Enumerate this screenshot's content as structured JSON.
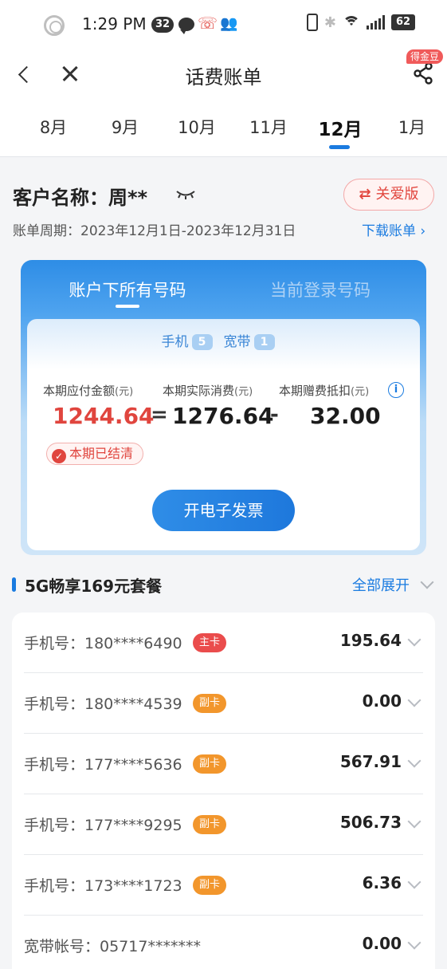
{
  "status_bar": {
    "time": "1:29 PM",
    "notif_count": "32",
    "battery": "62"
  },
  "nav": {
    "title": "话费账单",
    "share_tag": "得金豆"
  },
  "months": [
    "8月",
    "9月",
    "10月",
    "11月",
    "12月",
    "1月"
  ],
  "active_month": "12月",
  "customer": {
    "name": "客户名称：周**",
    "care_label": "关爱版",
    "period": "账单周期：2023年12月1日-2023年12月31日",
    "download": "下载账单 ›"
  },
  "account": {
    "tab_all": "账户下所有号码",
    "tab_current": "当前登录号码",
    "mobile_label": "手机",
    "mobile_count": "5",
    "broadband_label": "宽带",
    "broadband_count": "1",
    "payable_label": "本期应付金额",
    "actual_label": "本期实际消费",
    "deduct_label": "本期赠费抵扣",
    "unit": "(元)",
    "payable": "1244.64",
    "equals": "=",
    "actual": "1276.64",
    "minus": "-",
    "deduct": "32.00",
    "paid_status": "本期已结清",
    "invoice_button": "开电子发票"
  },
  "package": {
    "title": "5G畅享169元套餐",
    "expand": "全部展开"
  },
  "lines": [
    {
      "label": "手机号：180****6490",
      "tag": "主卡",
      "amount": "195.64"
    },
    {
      "label": "手机号：180****4539",
      "tag": "副卡",
      "amount": "0.00"
    },
    {
      "label": "手机号：177****5636",
      "tag": "副卡",
      "amount": "567.91"
    },
    {
      "label": "手机号：177****9295",
      "tag": "副卡",
      "amount": "506.73"
    },
    {
      "label": "手机号：173****1723",
      "tag": "副卡",
      "amount": "6.36"
    },
    {
      "label": "宽带帐号：05717*******",
      "tag": "",
      "amount": "0.00"
    }
  ],
  "colors": {
    "accent": "#1a7be0",
    "red": "#e0453e",
    "main_tag": "#ea4c4c",
    "sub_tag": "#f2962c"
  }
}
